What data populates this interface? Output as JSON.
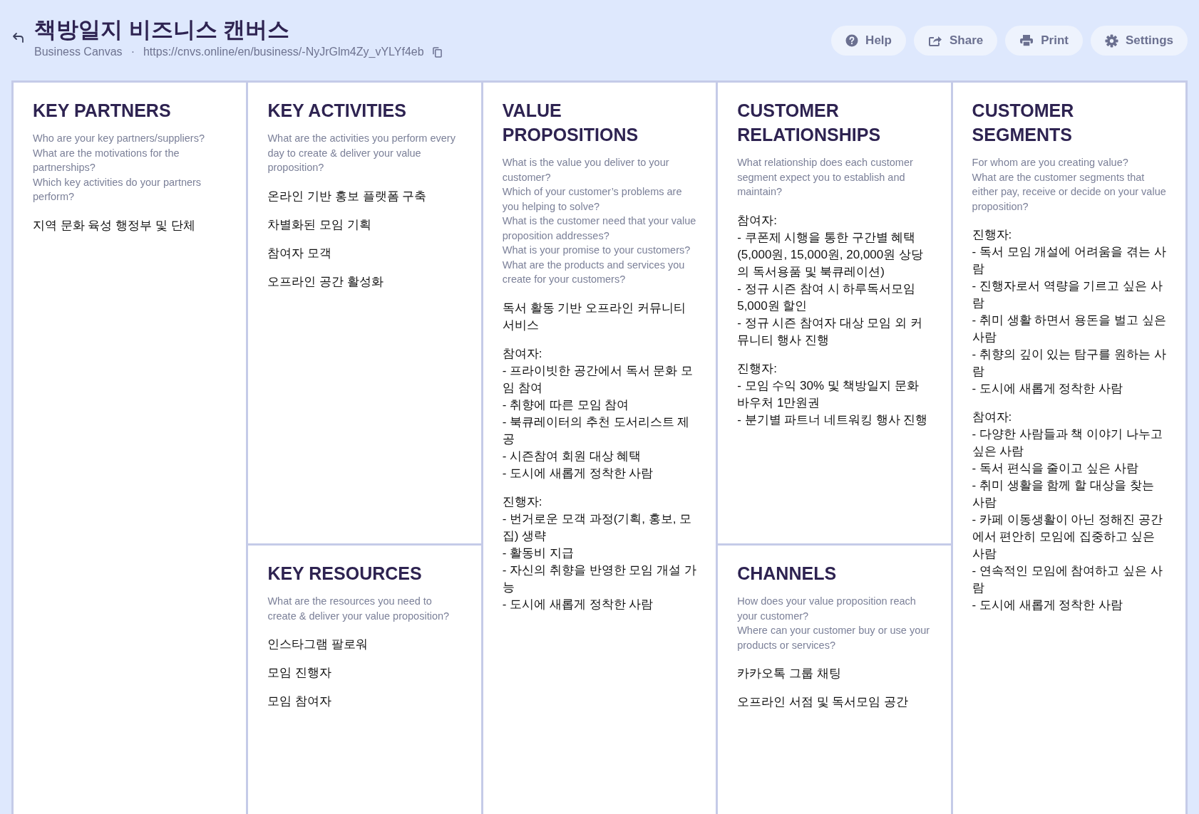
{
  "header": {
    "title": "책방일지 비즈니스 캔버스",
    "canvas_type": "Business Canvas",
    "separator": "·",
    "url": "https://cnvs.online/en/business/-NyJrGlm4Zy_vYLYf4eb"
  },
  "actions": [
    {
      "kind": "help",
      "label": "Help"
    },
    {
      "kind": "share",
      "label": "Share"
    },
    {
      "kind": "print",
      "label": "Print"
    },
    {
      "kind": "settings",
      "label": "Settings"
    }
  ],
  "blocks": [
    {
      "title": "KEY PARTNERS",
      "hint": "Who are your key partners/suppliers?\nWhat are the motivations for the partnerships?\nWhich key activities do your partners perform?",
      "notes": [
        "지역 문화 육성 행정부 및 단체"
      ]
    },
    {
      "title": "KEY ACTIVITIES",
      "hint": "What are the activities you perform every day to create & deliver your value proposition?",
      "notes": [
        "온라인 기반 홍보 플랫폼 구축",
        "차별화된 모임 기획",
        "참여자 모객",
        "오프라인 공간 활성화"
      ]
    },
    {
      "title": "KEY RESOURCES",
      "hint": "What are the resources you need to create & deliver your value proposition?",
      "notes": [
        "인스타그램 팔로워",
        "모임 진행자",
        "모임 참여자"
      ]
    },
    {
      "title": "VALUE PROPOSITIONS",
      "hint": "What is the value you deliver to your customer?\nWhich of your customer’s problems are you helping to solve?\nWhat is the customer need that your value proposition addresses?\nWhat is your promise to your customers?\nWhat are the products and services you create for your customers?",
      "notes": [
        "독서 활동 기반 오프라인 커뮤니티 서비스",
        "참여자:\n- 프라이빗한 공간에서 독서 문화 모임 참여\n- 취향에 따른 모임 참여\n- 북큐레이터의 추천 도서리스트 제공\n- 시즌참여 회원 대상 혜택\n- 도시에 새롭게 정착한 사람",
        "진행자:\n- 번거로운 모객 과정(기획, 홍보, 모집) 생략\n- 활동비 지급\n- 자신의 취향을 반영한 모임 개설 가능\n- 도시에 새롭게 정착한 사람"
      ]
    },
    {
      "title": "CUSTOMER RELATIONSHIPS",
      "hint": "What relationship does each customer segment expect you to establish and maintain?",
      "notes": [
        "참여자:\n- 쿠폰제 시행을 통한 구간별 혜택 (5,000원, 15,000원, 20,000원 상당의 독서용품 및 북큐레이션)\n- 정규 시즌 참여 시 하루독서모임 5,000원 할인\n- 정규 시즌 참여자 대상 모임 외 커뮤니티 행사 진행",
        "진행자:\n- 모임 수익 30% 및 책방일지 문화 바우처 1만원권\n- 분기별 파트너 네트워킹 행사 진행"
      ]
    },
    {
      "title": "CHANNELS",
      "hint": "How does your value proposition reach your customer?\nWhere can your customer buy or use your products or services?",
      "notes": [
        "카카오톡 그룹 채팅",
        "오프라인 서점 및 독서모임 공간"
      ]
    },
    {
      "title": "CUSTOMER SEGMENTS",
      "hint": "For whom are you creating value?\nWhat are the customer segments that either pay, receive or decide on your value proposition?",
      "notes": [
        "진행자:\n- 독서 모임 개설에 어려움을 겪는 사람\n- 진행자로서 역량을 기르고 싶은 사람\n- 취미 생활 하면서 용돈을 벌고 싶은 사람\n- 취향의 깊이 있는 탐구를 원하는 사람\n- 도시에 새롭게 정착한 사람",
        "참여자:\n- 다양한 사람들과 책 이야기 나누고 싶은 사람\n- 독서 편식을 줄이고 싶은 사람\n- 취미 생활을 함께 할 대상을 찾는 사람\n- 카페 이동생활이 아닌 정해진 공간에서 편안히 모임에 집중하고 싶은 사람\n- 연속적인 모임에 참여하고 싶은 사람\n- 도시에 새롭게 정착한 사람"
      ]
    }
  ]
}
